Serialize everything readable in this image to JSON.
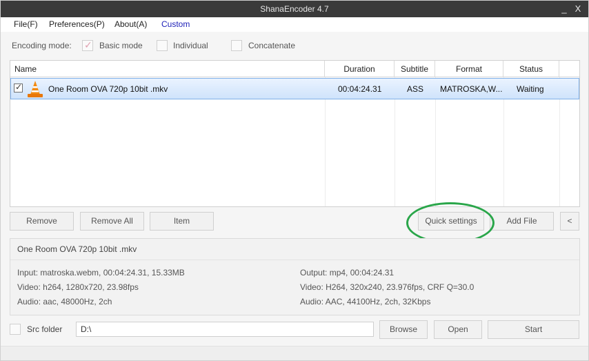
{
  "window": {
    "title": "ShanaEncoder 4.7",
    "minimize": "_",
    "close": "X"
  },
  "menu": {
    "file": "File(F)",
    "preferences": "Preferences(P)",
    "about": "About(A)",
    "custom": "Custom"
  },
  "mode": {
    "label": "Encoding mode:",
    "basic": "Basic mode",
    "individual": "Individual",
    "concatenate": "Concatenate",
    "basic_checked": true
  },
  "list": {
    "columns": [
      "Name",
      "Duration",
      "Subtitle",
      "Format",
      "Status"
    ],
    "rows": [
      {
        "checked": true,
        "name": "One Room OVA  720p 10bit .mkv",
        "duration": "00:04:24.31",
        "subtitle": "ASS",
        "format": "MATROSKA,W...",
        "status": "Waiting"
      }
    ]
  },
  "buttons": {
    "remove": "Remove",
    "remove_all": "Remove All",
    "item": "Item",
    "quick_settings": "Quick settings",
    "add_file": "Add File",
    "collapse": "<"
  },
  "info": {
    "filename": "One Room OVA  720p 10bit .mkv",
    "input": "Input: matroska.webm, 00:04:24.31, 15.33MB",
    "input_video": "Video: h264, 1280x720, 23.98fps",
    "input_audio": "Audio: aac, 48000Hz, 2ch",
    "output": "Output: mp4, 00:04:24.31",
    "output_video": "Video: H264, 320x240, 23.976fps, CRF Q=30.0",
    "output_audio": "Audio: AAC, 44100Hz, 2ch, 32Kbps"
  },
  "bottom": {
    "src_folder_label": "Src folder",
    "path_value": "D:\\",
    "browse": "Browse",
    "open": "Open",
    "start": "Start"
  },
  "colors": {
    "titlebar": "#3a3a3a",
    "selection": "#cfe3fb",
    "highlight_circle": "#2aa64a",
    "menu_custom": "#1e20b8"
  },
  "icons": {
    "row_icon": "vlc-cone-icon",
    "mode_check": "checkmark-icon"
  }
}
